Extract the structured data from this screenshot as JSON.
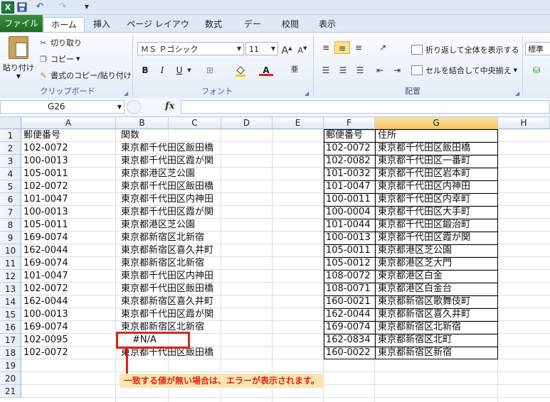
{
  "tabs": {
    "file": "ファイル",
    "home": "ホーム",
    "insert": "挿入",
    "page_layout": "ページ レイアウト",
    "formulas": "数式",
    "data": "データ",
    "review": "校閲",
    "view": "表示"
  },
  "clipboard": {
    "paste": "貼り付け",
    "cut": "切り取り",
    "copy": "コピー",
    "format_painter": "書式のコピー/貼り付け",
    "group_label": "クリップボード"
  },
  "font": {
    "name": "ＭＳ Ｐゴシック",
    "size": "11",
    "group_label": "フォント"
  },
  "alignment": {
    "wrap_text": "折り返して全体を表示する",
    "merge_center": "セルを結合して中央揃え",
    "group_label": "配置"
  },
  "number": {
    "format": "標準"
  },
  "formula_bar": {
    "name_box": "G26",
    "fx": "fx",
    "formula": ""
  },
  "columns": [
    "A",
    "B",
    "C",
    "D",
    "E",
    "F",
    "G",
    "H"
  ],
  "rows": [
    "1",
    "2",
    "3",
    "4",
    "5",
    "6",
    "7",
    "8",
    "9",
    "10",
    "11",
    "12",
    "13",
    "14",
    "15",
    "16",
    "17",
    "18",
    "19",
    "20",
    "21"
  ],
  "sheet": {
    "col_a_header": "郵便番号",
    "col_b_header": "関数",
    "col_a": [
      "102-0072",
      "100-0013",
      "105-0011",
      "102-0072",
      "101-0047",
      "100-0013",
      "105-0011",
      "169-0074",
      "162-0044",
      "169-0074",
      "101-0047",
      "102-0072",
      "162-0044",
      "100-0013",
      "169-0074",
      "102-0095",
      "102-0072"
    ],
    "col_b": [
      "東京都千代田区飯田橋",
      "東京都千代田区霞が関",
      "東京都港区芝公園",
      "東京都千代田区飯田橋",
      "東京都千代田区内神田",
      "東京都千代田区霞が関",
      "東京都港区芝公園",
      "東京都新宿区北新宿",
      "東京都新宿区喜久井町",
      "東京都新宿区北新宿",
      "東京都千代田区内神田",
      "東京都千代田区飯田橋",
      "東京都新宿区喜久井町",
      "東京都千代田区霞が関",
      "東京都新宿区北新宿",
      "#N/A",
      "東京都千代田区飯田橋"
    ],
    "lookup_header_f": "郵便番号",
    "lookup_header_g": "住所",
    "col_f": [
      "102-0072",
      "102-0082",
      "101-0032",
      "101-0047",
      "100-0011",
      "100-0004",
      "101-0044",
      "100-0013",
      "105-0011",
      "105-0012",
      "108-0072",
      "108-0071",
      "160-0021",
      "162-0044",
      "169-0074",
      "162-0834",
      "160-0022"
    ],
    "col_g": [
      "東京都千代田区飯田橋",
      "東京都千代田区一番町",
      "東京都千代田区岩本町",
      "東京都千代田区内神田",
      "東京都千代田区内幸町",
      "東京都千代田区大手町",
      "東京都千代田区鍛治町",
      "東京都千代田区霞が関",
      "東京都港区芝公園",
      "東京都港区芝大門",
      "東京都港区白金",
      "東京都港区白金台",
      "東京都新宿区歌舞伎町",
      "東京都新宿区喜久井町",
      "東京都新宿区北新宿",
      "東京都新宿区北町",
      "東京都新宿区新宿"
    ]
  },
  "annotation": {
    "text": "一致する値が無い場合は、エラーが表示されます。",
    "color": "#e0231a"
  }
}
